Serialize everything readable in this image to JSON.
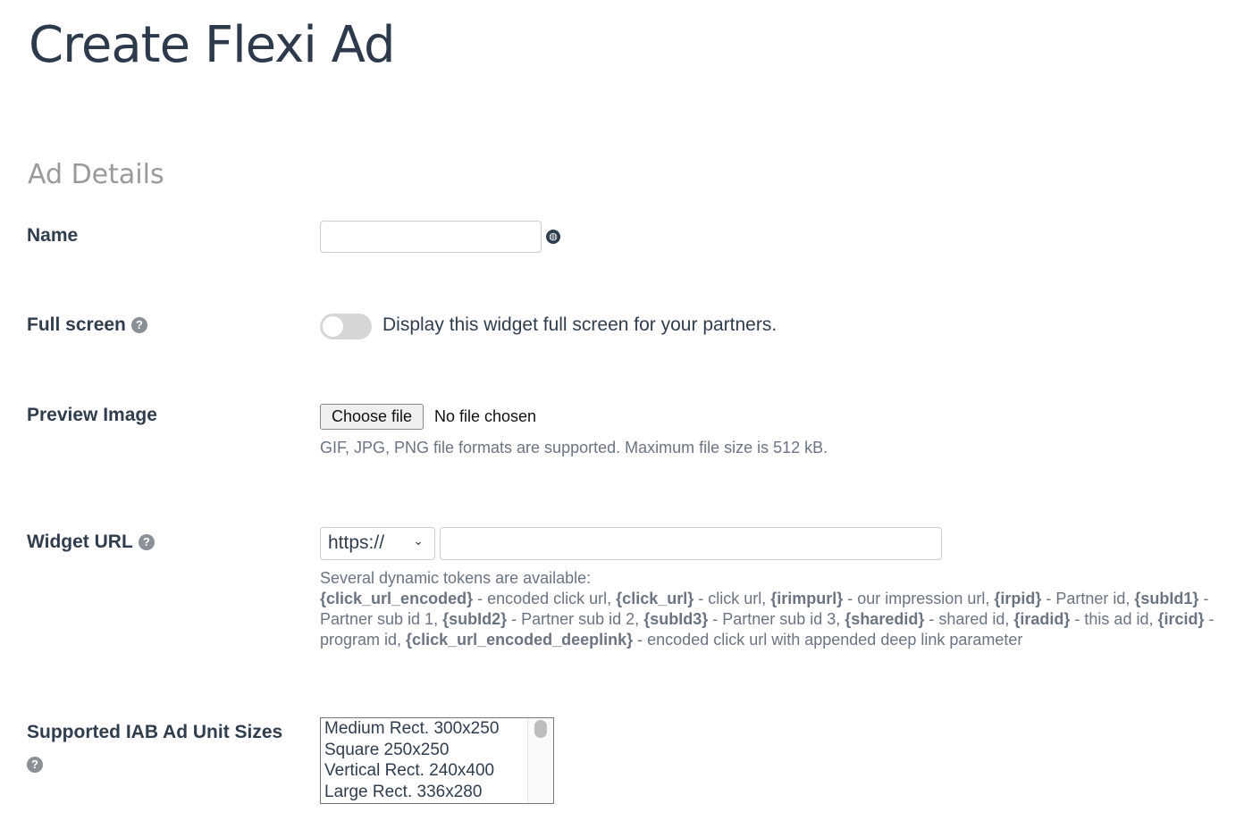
{
  "title": "Create Flexi Ad",
  "section": "Ad Details",
  "name": {
    "label": "Name",
    "value": "",
    "icon": "globe-icon"
  },
  "fullscreen": {
    "label": "Full screen",
    "enabled": false,
    "description": "Display this widget full screen for your partners."
  },
  "preview": {
    "label": "Preview Image",
    "button": "Choose file",
    "status": "No file chosen",
    "hint": "GIF, JPG, PNG file formats are supported. Maximum file size is 512 kB."
  },
  "widget_url": {
    "label": "Widget URL",
    "protocol": "https://",
    "value": "",
    "hint_intro": "Several dynamic tokens are available:",
    "tokens": [
      {
        "token": "{click_url_encoded}",
        "desc": " - encoded click url, "
      },
      {
        "token": "{click_url}",
        "desc": " - click url, "
      },
      {
        "token": "{irimpurl}",
        "desc": " - our impression url, "
      },
      {
        "token": "{irpid}",
        "desc": " - Partner id, "
      },
      {
        "token": "{subId1}",
        "desc": " - Partner sub id 1, "
      },
      {
        "token": "{subId2}",
        "desc": " - Partner sub id 2, "
      },
      {
        "token": "{subId3}",
        "desc": " - Partner sub id 3, "
      },
      {
        "token": "{sharedid}",
        "desc": " - shared id, "
      },
      {
        "token": "{iradid}",
        "desc": " - this ad id, "
      },
      {
        "token": "{ircid}",
        "desc": " - program id, "
      },
      {
        "token": "{click_url_encoded_deeplink}",
        "desc": " - encoded click url with appended deep link parameter"
      }
    ]
  },
  "sizes": {
    "label": "Supported IAB Ad Unit Sizes",
    "options": [
      "Medium Rect. 300x250",
      "Square 250x250",
      "Vertical Rect. 240x400",
      "Large Rect. 336x280"
    ]
  }
}
